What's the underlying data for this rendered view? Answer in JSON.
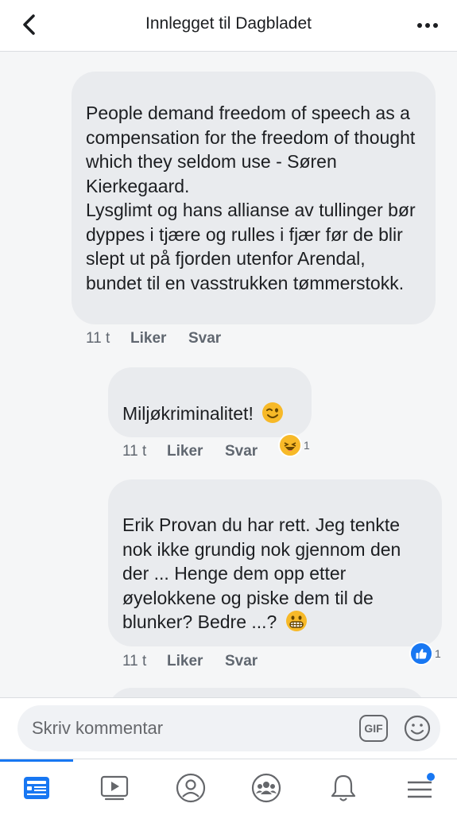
{
  "header": {
    "title": "Innlegget til Dagbladet"
  },
  "comments": [
    {
      "text": "People demand freedom of speech as a compensation for the freedom of thought which they seldom use - Søren Kierkegaard.\nLysglimt og hans allianse av tullinger bør dyppes i tjære og rulles i fjær før de blir slept ut på fjorden utenfor Arendal, bundet til en vasstrukken tømmerstokk.",
      "time": "11 t",
      "like": "Liker",
      "reply": "Svar"
    },
    {
      "text": "Miljøkriminalitet!",
      "emoji": "winking-face",
      "time": "11 t",
      "like": "Liker",
      "reply": "Svar",
      "reaction": {
        "icon": "haha",
        "count": "1"
      }
    },
    {
      "text": "Erik  Provan du har rett. Jeg tenkte nok ikke grundig nok gjennom den der ... Henge dem opp etter øyelokkene og piske dem til de blunker? Bedre ...?",
      "emoji": "grimacing-face",
      "time": "11 t",
      "like": "Liker",
      "reply": "Svar",
      "reaction": {
        "icon": "like",
        "count": "1"
      }
    }
  ],
  "composer": {
    "placeholder": "Skriv kommentar",
    "gif_label": "GIF"
  },
  "tabs": [
    "news-feed",
    "watch",
    "profile",
    "groups",
    "notifications",
    "menu"
  ],
  "colors": {
    "accent": "#1877f2",
    "bubble": "#e9ebee",
    "reaction_like": "#1877f2",
    "reaction_haha": "#f7b928"
  }
}
